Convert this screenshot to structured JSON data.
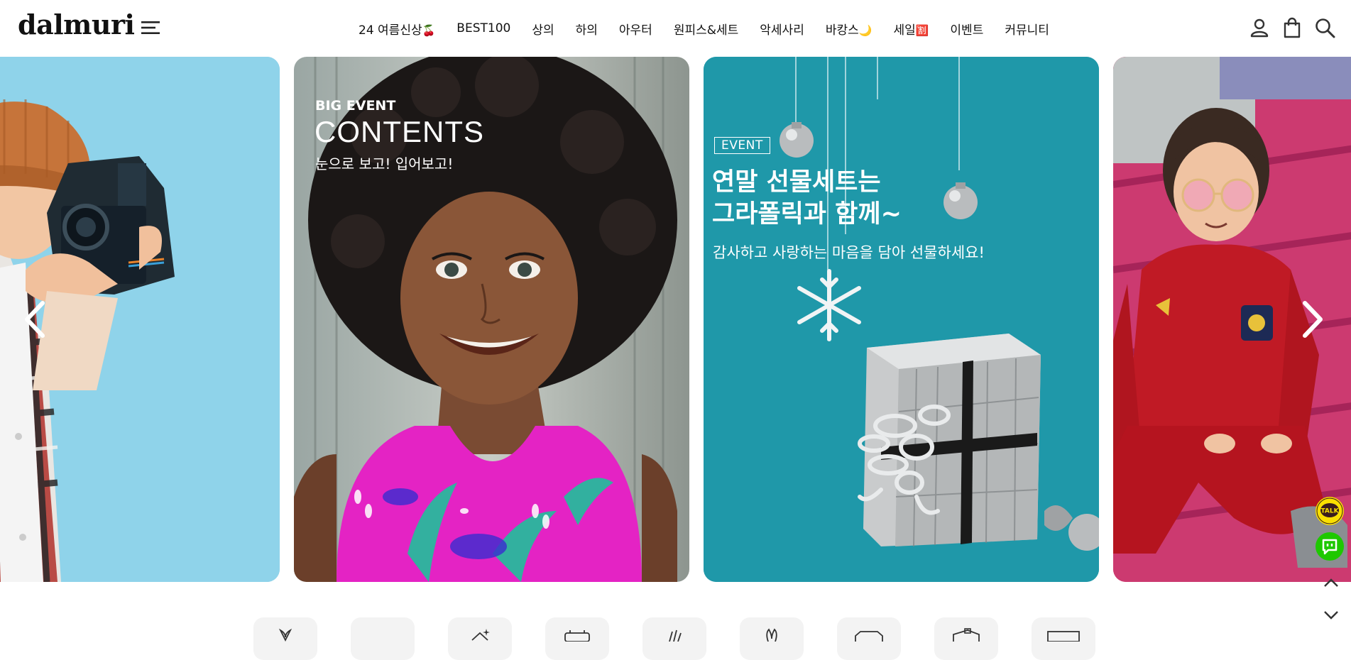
{
  "header": {
    "logo": "dalmuri",
    "nav": [
      {
        "label": "24 여름신상",
        "emoji": "🍒"
      },
      {
        "label": "BEST100",
        "emoji": ""
      },
      {
        "label": "상의",
        "emoji": ""
      },
      {
        "label": "하의",
        "emoji": ""
      },
      {
        "label": "아우터",
        "emoji": ""
      },
      {
        "label": "원피스&세트",
        "emoji": ""
      },
      {
        "label": "악세사리",
        "emoji": ""
      },
      {
        "label": "바캉스",
        "emoji": "🌙"
      },
      {
        "label": "세일",
        "emoji": "🈹"
      },
      {
        "label": "이벤트",
        "emoji": ""
      },
      {
        "label": "커뮤니티",
        "emoji": ""
      }
    ],
    "icons": [
      "menu-icon",
      "user-icon",
      "shopping-bag-icon",
      "search-icon"
    ]
  },
  "slider": {
    "slides": [
      {
        "name": "photographer-kid"
      },
      {
        "name": "contents",
        "label": "BIG EVENT",
        "title": "CONTENTS",
        "subtitle": "눈으로 보고! 입어보고!"
      },
      {
        "name": "event-gift",
        "badge": "EVENT",
        "title_line1": "연말 선물세트는",
        "title_line2": "그라폴릭과 함께~",
        "subtitle": "감사하고 사랑하는 마음을 담아 선물하세요!"
      },
      {
        "name": "red-outfit-kid"
      }
    ],
    "prev_icon": "chevron-left-icon",
    "next_icon": "chevron-right-icon"
  },
  "floating": {
    "talk_label": "TALK",
    "talk_color": "#f9e000",
    "chat_color": "#1ec800"
  },
  "categories": [
    "cat-1",
    "cat-2",
    "cat-3",
    "cat-4",
    "cat-5",
    "cat-6",
    "cat-7",
    "cat-8",
    "cat-9"
  ]
}
